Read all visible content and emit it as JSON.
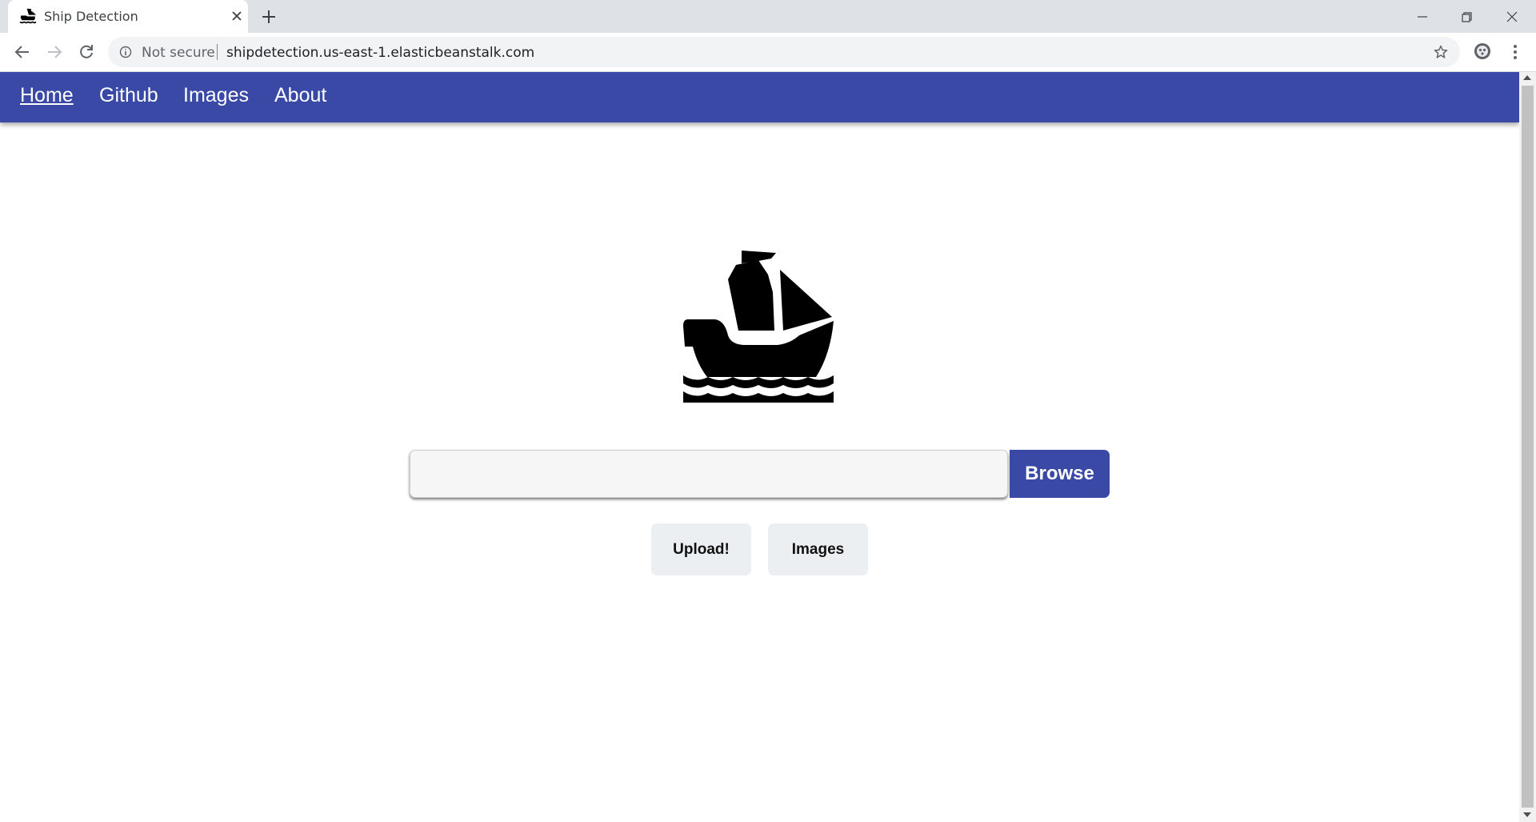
{
  "browser": {
    "tab_title": "Ship Detection",
    "security_label": "Not secure",
    "url": "shipdetection.us-east-1.elasticbeanstalk.com"
  },
  "nav": {
    "items": [
      "Home",
      "Github",
      "Images",
      "About"
    ],
    "active": "Home"
  },
  "upload": {
    "browse_label": "Browse",
    "upload_label": "Upload!",
    "images_label": "Images"
  },
  "colors": {
    "primary": "#3949a5",
    "button_bg": "#eceff1",
    "tabstrip": "#dee1e6"
  },
  "icons": {
    "logo": "ship-icon",
    "favicon": "ship-icon"
  }
}
